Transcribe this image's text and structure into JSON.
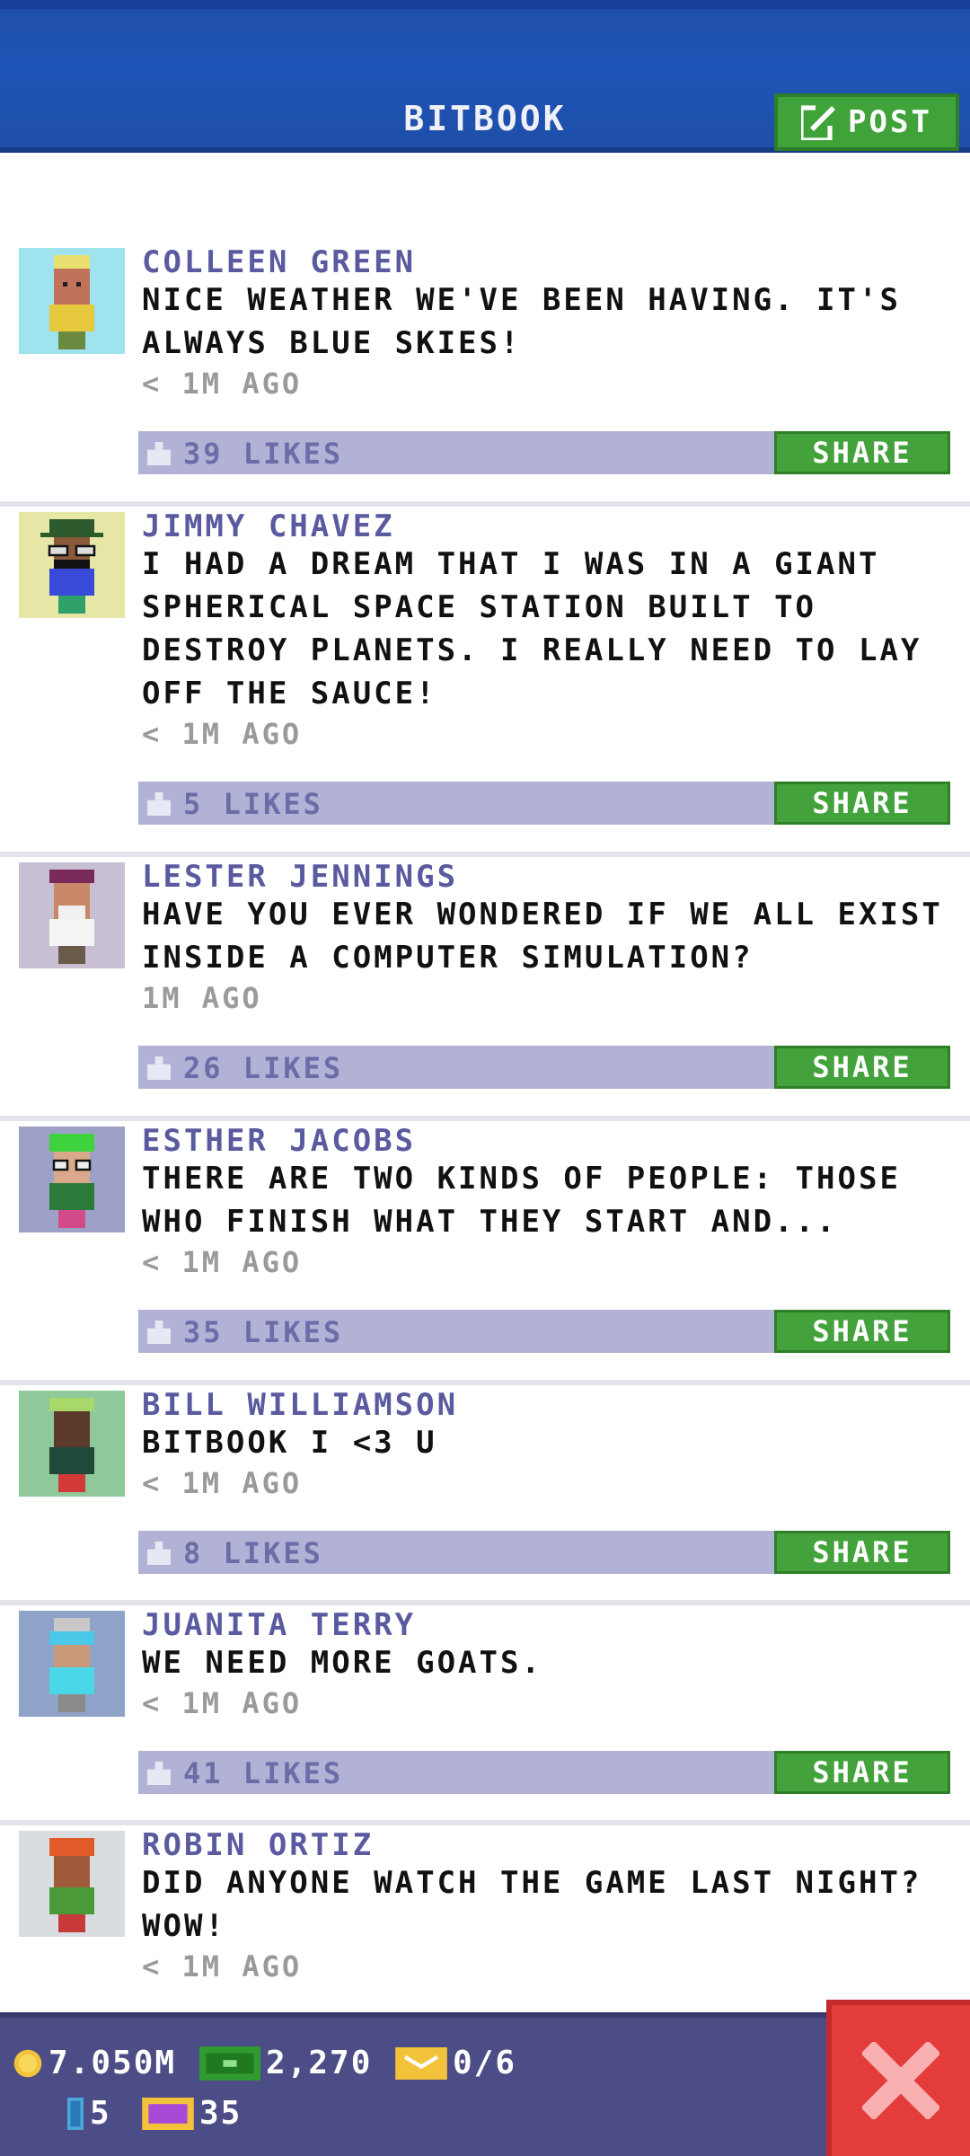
{
  "header": {
    "title": "BITBOOK",
    "post_label": "POST"
  },
  "posts": [
    {
      "author": "COLLEEN GREEN",
      "message": "NICE WEATHER WE'VE BEEN HAVING. IT'S ALWAYS BLUE SKIES!",
      "time": "< 1M AGO",
      "likes": "39 LIKES",
      "share": "SHARE",
      "avatar_bg": "#9fe3ee"
    },
    {
      "author": "JIMMY CHAVEZ",
      "message": "I HAD A DREAM THAT I WAS IN A GIANT SPHERICAL SPACE STATION BUILT TO DESTROY PLANETS. I REALLY NEED TO LAY OFF THE SAUCE!",
      "time": "< 1M AGO",
      "likes": "5 LIKES",
      "share": "SHARE",
      "avatar_bg": "#e6e6a6"
    },
    {
      "author": "LESTER JENNINGS",
      "message": "HAVE YOU EVER WONDERED IF WE ALL EXIST INSIDE A COMPUTER SIMULATION?",
      "time": "1M AGO",
      "likes": "26 LIKES",
      "share": "SHARE",
      "avatar_bg": "#c9bfd3"
    },
    {
      "author": "ESTHER JACOBS",
      "message": "THERE ARE TWO KINDS OF PEOPLE: THOSE WHO FINISH WHAT THEY START AND...",
      "time": "< 1M AGO",
      "likes": "35 LIKES",
      "share": "SHARE",
      "avatar_bg": "#9ea1c7"
    },
    {
      "author": "BILL WILLIAMSON",
      "message": "BITBOOK I <3 U",
      "time": "< 1M AGO",
      "likes": "8 LIKES",
      "share": "SHARE",
      "avatar_bg": "#8fc89a"
    },
    {
      "author": "JUANITA TERRY",
      "message": "WE NEED MORE GOATS.",
      "time": "< 1M AGO",
      "likes": "41 LIKES",
      "share": "SHARE",
      "avatar_bg": "#8fa3c9"
    },
    {
      "author": "ROBIN ORTIZ",
      "message": "DID ANYONE WATCH THE GAME LAST NIGHT? WOW!",
      "time": "< 1M AGO",
      "likes": "",
      "share": "",
      "avatar_bg": "#d9dde0"
    }
  ],
  "status": {
    "coins": "7.050M",
    "bux": "2,270",
    "tickets": "0/6",
    "items": "5",
    "vip": "35"
  },
  "icons": {
    "post": "edit-icon",
    "like": "thumb-up-icon",
    "coin": "coin-icon",
    "bux": "bux-icon",
    "ticket": "ticket-icon",
    "item": "elevator-icon",
    "vip": "vip-icon",
    "close": "close-icon"
  },
  "colors": {
    "header": "#1f55b8",
    "share": "#43a23b",
    "likebar": "#b1b2d6",
    "bottom": "#4c4c86",
    "close": "#e43b3b"
  }
}
